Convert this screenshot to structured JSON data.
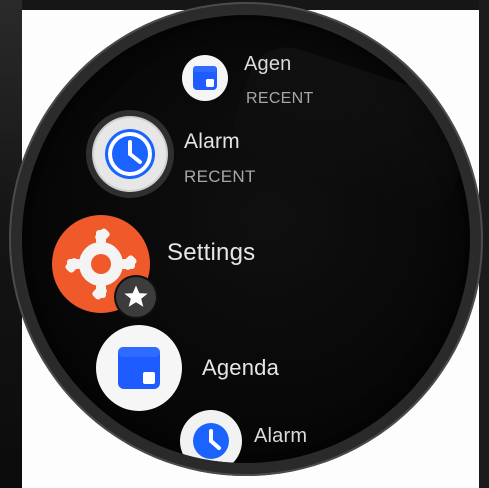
{
  "watch": {
    "list": [
      {
        "id": "agenda-recent",
        "title": "Agen",
        "subtitle": "RECENT"
      },
      {
        "id": "alarm-recent",
        "title": "Alarm",
        "subtitle": "RECENT"
      },
      {
        "id": "settings",
        "title": "Settings",
        "subtitle": ""
      },
      {
        "id": "agenda",
        "title": "Agenda",
        "subtitle": ""
      },
      {
        "id": "alarm",
        "title": "Alarm",
        "subtitle": ""
      }
    ]
  },
  "colors": {
    "background": "#070707",
    "settings_orange": "#f05a2a",
    "alarm_blue": "#1a63ff",
    "agenda_blue": "#1f5cff",
    "text_primary": "#e6e6e6",
    "text_secondary": "#a7a7a7"
  },
  "icons": {
    "agenda": "calendar-icon",
    "alarm": "clock-icon",
    "settings": "gear-icon",
    "favorite_badge": "star-icon"
  }
}
